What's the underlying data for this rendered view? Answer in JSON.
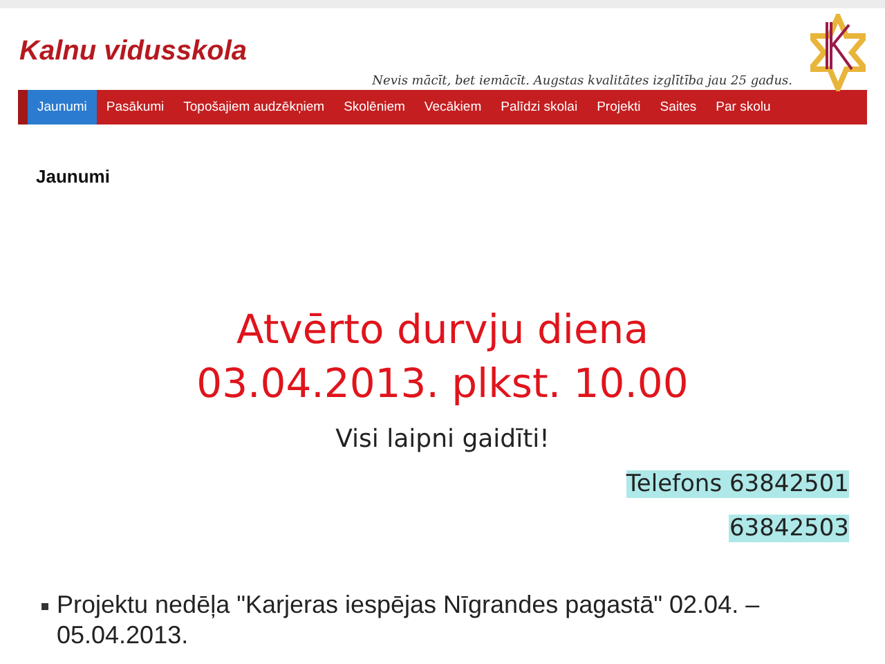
{
  "site": {
    "title": "Kalnu vidusskola",
    "tagline": "Nevis mācīt, bet iemācīt. Augstas kvalitātes izglītība jau 25 gadus."
  },
  "nav": [
    {
      "label": "Jaunumi",
      "selected": true
    },
    {
      "label": "Pasākumi",
      "selected": false
    },
    {
      "label": "Topošajiem audzēkņiem",
      "selected": false
    },
    {
      "label": "Skolēniem",
      "selected": false
    },
    {
      "label": "Vecākiem",
      "selected": false
    },
    {
      "label": "Palīdzi skolai",
      "selected": false
    },
    {
      "label": "Projekti",
      "selected": false
    },
    {
      "label": "Saites",
      "selected": false
    },
    {
      "label": "Par skolu",
      "selected": false
    }
  ],
  "page_heading": "Jaunumi",
  "announcement": {
    "headline": [
      "Atvērto durvju diena",
      "03.04.2013. plkst. 10.00"
    ],
    "subtitle": "Visi laipni gaidīti!",
    "phones": [
      "Telefons 63842501",
      "63842503"
    ]
  },
  "news": [
    "Projektu nedēļa \"Karjeras iespējas Nīgrandes pagastā\" 02.04. – 05.04.2013."
  ]
}
